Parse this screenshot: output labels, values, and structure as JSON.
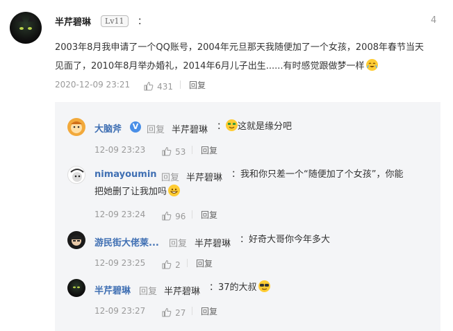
{
  "main_comment": {
    "username": "半芹碧琳",
    "level": "Lv11",
    "colon": "：",
    "floor": "4",
    "text": "2003年8月我申请了一个QQ账号，2004年元旦那天我随便加了一个女孩，2008年春节当天见面了，2010年8月举办婚礼，2014年6月儿子出生......有时感觉跟做梦一样",
    "time": "2020-12-09 23:21",
    "likes": "431",
    "reply_label": "回复"
  },
  "replies": [
    {
      "username": "大脑斧",
      "verified": "V",
      "reply_word": "回复",
      "target": "半芹碧琳",
      "colon": "：",
      "text": "这就是缘分吧",
      "time": "12-09 23:23",
      "likes": "53",
      "reply_label": "回复"
    },
    {
      "username": "nimayoumin",
      "reply_word": "回复",
      "target": "半芹碧琳",
      "colon": "：",
      "text_line1": "我和你只差一个“随便加了个女孩”，你能",
      "text_line2": "把她删了让我加吗",
      "time": "12-09 23:24",
      "likes": "96",
      "reply_label": "回复"
    },
    {
      "username": "游民街大佬莱...",
      "reply_word": "回复",
      "target": "半芹碧琳",
      "colon": "：",
      "text": "好奇大哥你今年多大",
      "time": "12-09 23:25",
      "likes": "2",
      "reply_label": "回复"
    },
    {
      "username": "半芹碧琳",
      "reply_word": "回复",
      "target": "半芹碧琳",
      "colon": "：",
      "text": "37的大叔",
      "time": "12-09 23:27",
      "likes": "27",
      "reply_label": "回复"
    }
  ],
  "icons": {
    "thumb": "thumbs-up-icon",
    "emoji_main": "teary-laugh-emoji-icon",
    "emoji_r1": "money-eyes-emoji-icon",
    "emoji_r2": "grin-emoji-icon",
    "emoji_r4": "sunglasses-emoji-icon"
  }
}
